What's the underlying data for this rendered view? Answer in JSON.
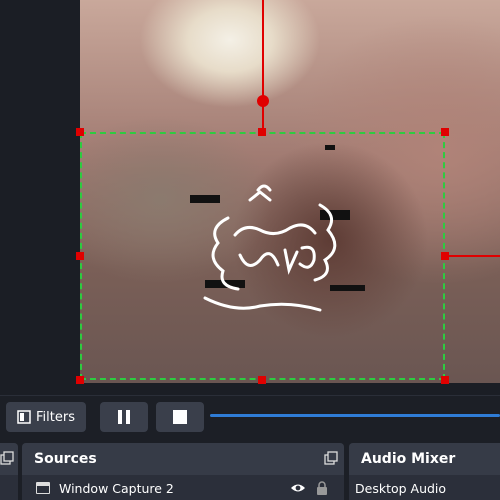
{
  "toolbar": {
    "filters_label": "Filters",
    "pause_icon": "pause-icon",
    "stop_icon": "stop-icon",
    "accent": "#2f7cd6"
  },
  "sources": {
    "title": "Sources",
    "items": [
      {
        "label": "Window Capture 2",
        "icon": "window-icon",
        "visible": true,
        "locked": false
      }
    ]
  },
  "audio_mixer": {
    "title": "Audio Mixer",
    "channels": [
      {
        "label": "Desktop Audio"
      }
    ]
  },
  "preview": {
    "selection_color": "#2ecc40",
    "handle_color": "#e00000"
  }
}
